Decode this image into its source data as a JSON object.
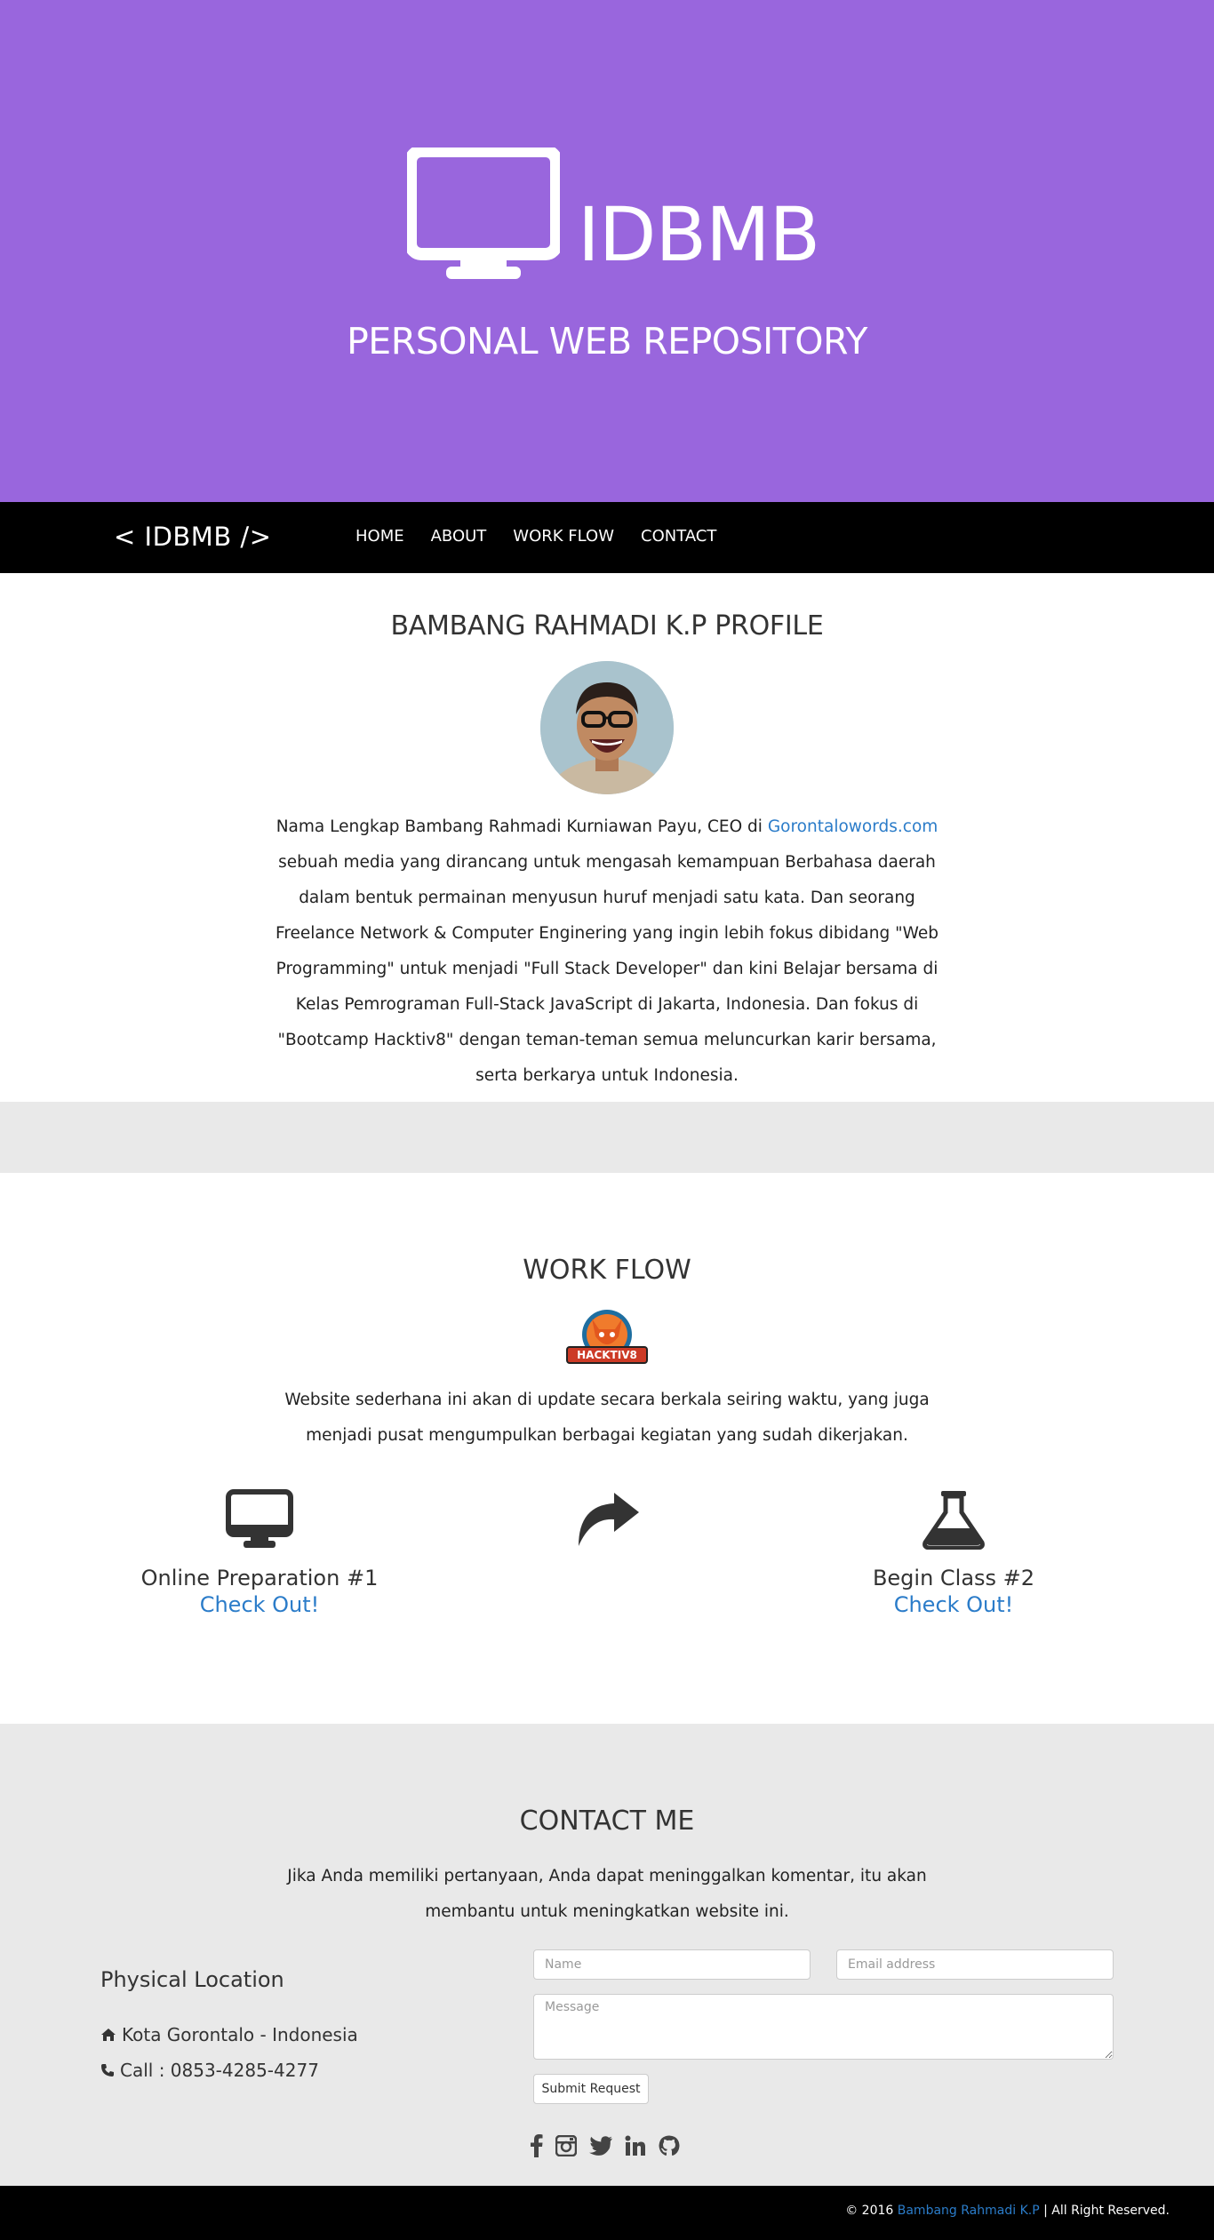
{
  "hero": {
    "brand": "IDBMB",
    "subtitle": "PERSONAL WEB REPOSITORY",
    "logo_icon": "desktop-icon"
  },
  "nav": {
    "brand": "< IDBMB />",
    "links": [
      "HOME",
      "ABOUT",
      "WORK FLOW",
      "CONTACT"
    ]
  },
  "profile": {
    "title": "BAMBANG RAHMADI K.P PROFILE",
    "text_before_link": "Nama Lengkap Bambang Rahmadi Kurniawan Payu, CEO di ",
    "link_text": "Gorontalowords.com",
    "text_after_link": " sebuah media yang dirancang untuk mengasah kemampuan Berbahasa daerah dalam bentuk permainan menyusun huruf menjadi satu kata. Dan seorang Freelance Network & Computer Enginering yang ingin lebih fokus dibidang \"Web Programming\" untuk menjadi \"Full Stack Developer\" dan kini Belajar bersama di Kelas Pemrograman Full-Stack JavaScript di Jakarta, Indonesia. Dan fokus di \"Bootcamp Hacktiv8\" dengan teman-teman semua meluncurkan karir bersama, serta berkarya untuk Indonesia."
  },
  "workflow": {
    "title": "WORK FLOW",
    "logo_text": "HACKTIV8",
    "text": "Website sederhana ini akan di update secara berkala seiring waktu, yang juga menjadi pusat mengumpulkan berbagai kegiatan yang sudah dikerjakan.",
    "items": [
      {
        "icon": "desktop-icon",
        "title": "Online Preparation #1",
        "link": "Check Out!"
      },
      {
        "icon": "share-arrow-icon"
      },
      {
        "icon": "flask-icon",
        "title": "Begin Class #2",
        "link": "Check Out!"
      }
    ]
  },
  "contact": {
    "title": "CONTACT ME",
    "text": "Jika Anda memiliki pertanyaan, Anda dapat meninggalkan komentar, itu akan membantu untuk meningkatkan website ini.",
    "location_title": "Physical Location",
    "address": "Kota Gorontalo - Indonesia",
    "phone": "Call : 0853-4285-4277",
    "name_placeholder": "Name",
    "email_placeholder": "Email address",
    "message_placeholder": "Message",
    "submit_label": "Submit Request",
    "socials": [
      "facebook-icon",
      "instagram-icon",
      "twitter-icon",
      "linkedin-icon",
      "github-icon"
    ]
  },
  "footer": {
    "prefix": "© 2016 ",
    "link": "Bambang Rahmadi K.P",
    "suffix": " | All Right Reserved."
  },
  "colors": {
    "hero_bg": "#9966dd",
    "link": "#2b7cc9",
    "gray_bg": "#e9e9e9"
  }
}
